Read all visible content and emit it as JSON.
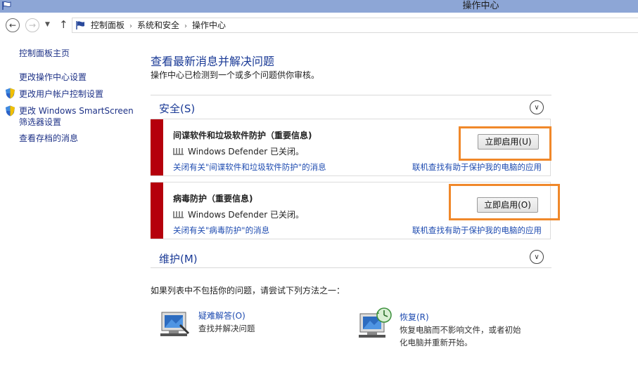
{
  "window": {
    "title": "操作中心"
  },
  "breadcrumb": {
    "items": [
      "控制面板",
      "系统和安全",
      "操作中心"
    ]
  },
  "sidebar": {
    "items": [
      {
        "label": "控制面板主页"
      },
      {
        "label": "更改操作中心设置"
      },
      {
        "label": "更改用户帐户控制设置",
        "icon": "shield-icon"
      },
      {
        "label": "更改 Windows SmartScreen",
        "label2": "筛选器设置",
        "icon": "shield-icon"
      },
      {
        "label": "查看存档的消息"
      }
    ]
  },
  "main": {
    "title": "查看最新消息并解决问题",
    "subtitle": "操作中心已检测到一个或多个问题供你审核。",
    "security_section": {
      "label": "安全(S)"
    },
    "maintenance_section": {
      "label": "维护(M)"
    },
    "cards": [
      {
        "title": "间谍软件和垃圾软件防护（重要信息)",
        "status": "Windows Defender 已关闭。",
        "button": "立即启用(U)",
        "link_left": "关闭有关\"间谍软件和垃圾软件防护\"的消息",
        "link_right": "联机查找有助于保护我的电脑的应用"
      },
      {
        "title": "病毒防护（重要信息)",
        "status": "Windows Defender 已关闭。",
        "button": "立即启用(O)",
        "link_left": "关闭有关\"病毒防护\"的消息",
        "link_right": "联机查找有助于保护我的电脑的应用"
      }
    ],
    "bottom_note": "如果列表中不包括你的问题，请尝试下列方法之一：",
    "tools": [
      {
        "name": "疑难解答(O)",
        "desc": "查找并解决问题",
        "icon": "troubleshoot-icon"
      },
      {
        "name": "恢复(R)",
        "desc": "恢复电脑而不影响文件，或者初始化电脑并重新开始。",
        "icon": "recovery-icon"
      }
    ]
  },
  "colors": {
    "accent": "#1a3a96",
    "critical": "#b5000c",
    "highlight": "#f0882a",
    "titlebar": "#8da6d6"
  }
}
